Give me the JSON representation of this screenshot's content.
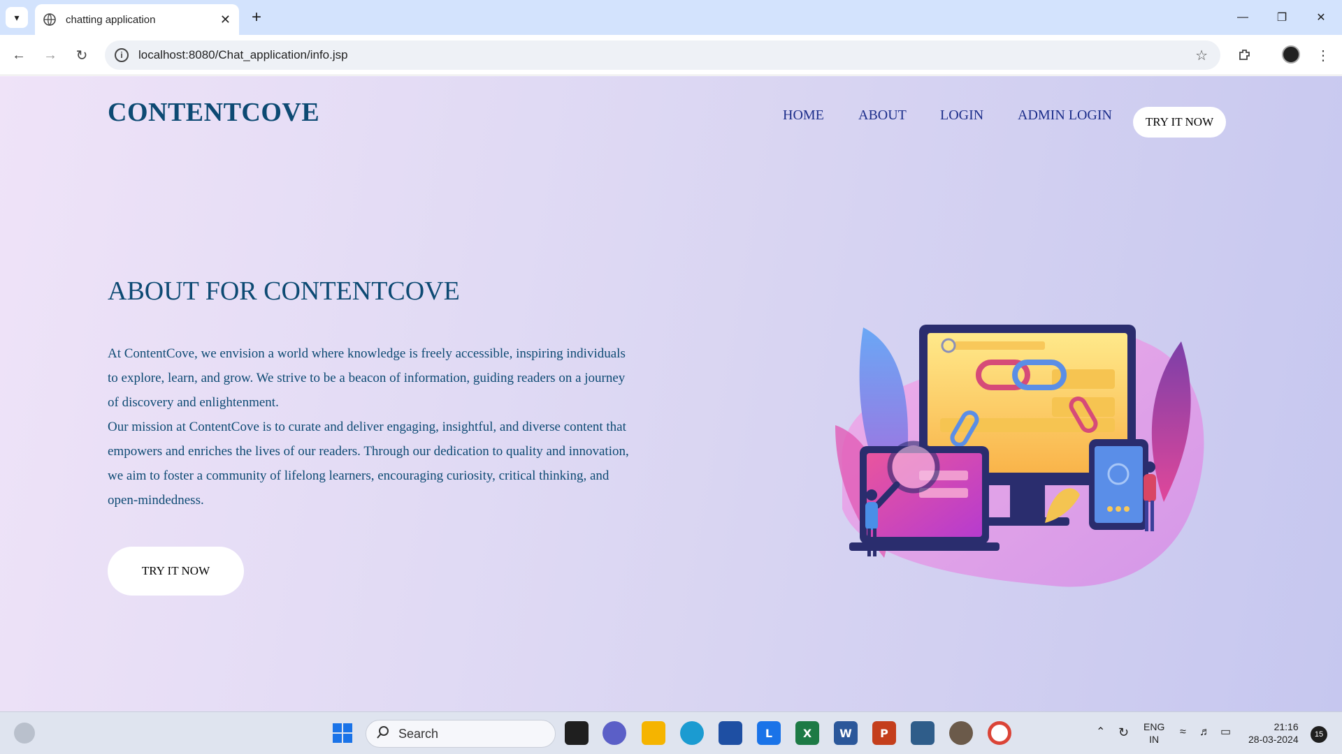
{
  "browser": {
    "tab_title": "chatting application",
    "url": "localhost:8080/Chat_application/info.jsp"
  },
  "site": {
    "logo": "CONTENTCOVE",
    "nav": [
      "HOME",
      "ABOUT",
      "LOGIN",
      "ADMIN LOGIN"
    ],
    "nav_cta": "TRY IT NOW",
    "heading": "ABOUT FOR CONTENTCOVE",
    "paragraph_1": "At ContentCove, we envision a world where knowledge is freely accessible, inspiring individuals to explore, learn, and grow. We strive to be a beacon of information, guiding readers on a journey of discovery and enlightenment.",
    "paragraph_2": "Our mission at ContentCove is to curate and deliver engaging, insightful, and diverse content that empowers and enriches the lives of our readers. Through our dedication to quality and innovation, we aim to foster a community of lifelong learners, encouraging curiosity, critical thinking, and open-mindedness.",
    "cta": "TRY IT NOW"
  },
  "taskbar": {
    "search_placeholder": "Search",
    "lang_top": "ENG",
    "lang_bottom": "IN",
    "time": "21:16",
    "date": "28-03-2024",
    "notifications": "15"
  },
  "colors": {
    "brand": "#0d4a73",
    "nav": "#1b2d8a"
  }
}
